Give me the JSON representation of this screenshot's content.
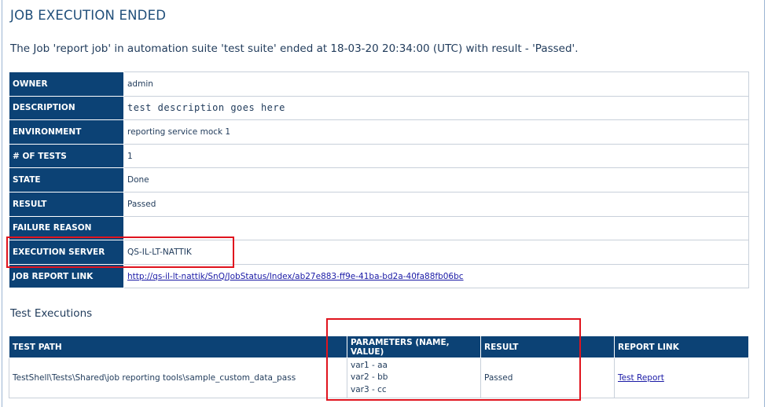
{
  "header": {
    "title": "JOB EXECUTION ENDED",
    "summary": "The Job 'report job' in automation suite 'test suite' ended at 18-03-20 20:34:00 (UTC) with result - 'Passed'."
  },
  "job_info": {
    "rows": [
      {
        "key": "OWNER",
        "value": "admin"
      },
      {
        "key": "DESCRIPTION",
        "value": "test description goes here"
      },
      {
        "key": "ENVIRONMENT",
        "value": "reporting service mock 1"
      },
      {
        "key": "# OF TESTS",
        "value": "1"
      },
      {
        "key": "STATE",
        "value": "Done"
      },
      {
        "key": "RESULT",
        "value": "Passed"
      },
      {
        "key": "FAILURE REASON",
        "value": ""
      },
      {
        "key": "EXECUTION SERVER",
        "value": "QS-IL-LT-NATTIK"
      },
      {
        "key": "JOB REPORT LINK",
        "value": "http://qs-il-lt-nattik/SnQ/JobStatus/Index/ab27e883-ff9e-41ba-bd2a-40fa88fb06bc"
      }
    ]
  },
  "test_executions": {
    "heading": "Test Executions",
    "columns": [
      "TEST PATH",
      "PARAMETERS (NAME, VALUE)",
      "RESULT",
      "REPORT LINK"
    ],
    "rows": [
      {
        "test_path": "TestShell\\Tests\\Shared\\job reporting tools\\sample_custom_data_pass",
        "parameters": [
          "var1 - aa",
          "var2 - bb",
          "var3 - cc"
        ],
        "result": "Passed",
        "report_link": "Test Report"
      }
    ]
  },
  "colors": {
    "header_bg": "#0c4275",
    "highlight": "#e0141e",
    "link": "#1a1aa6"
  }
}
